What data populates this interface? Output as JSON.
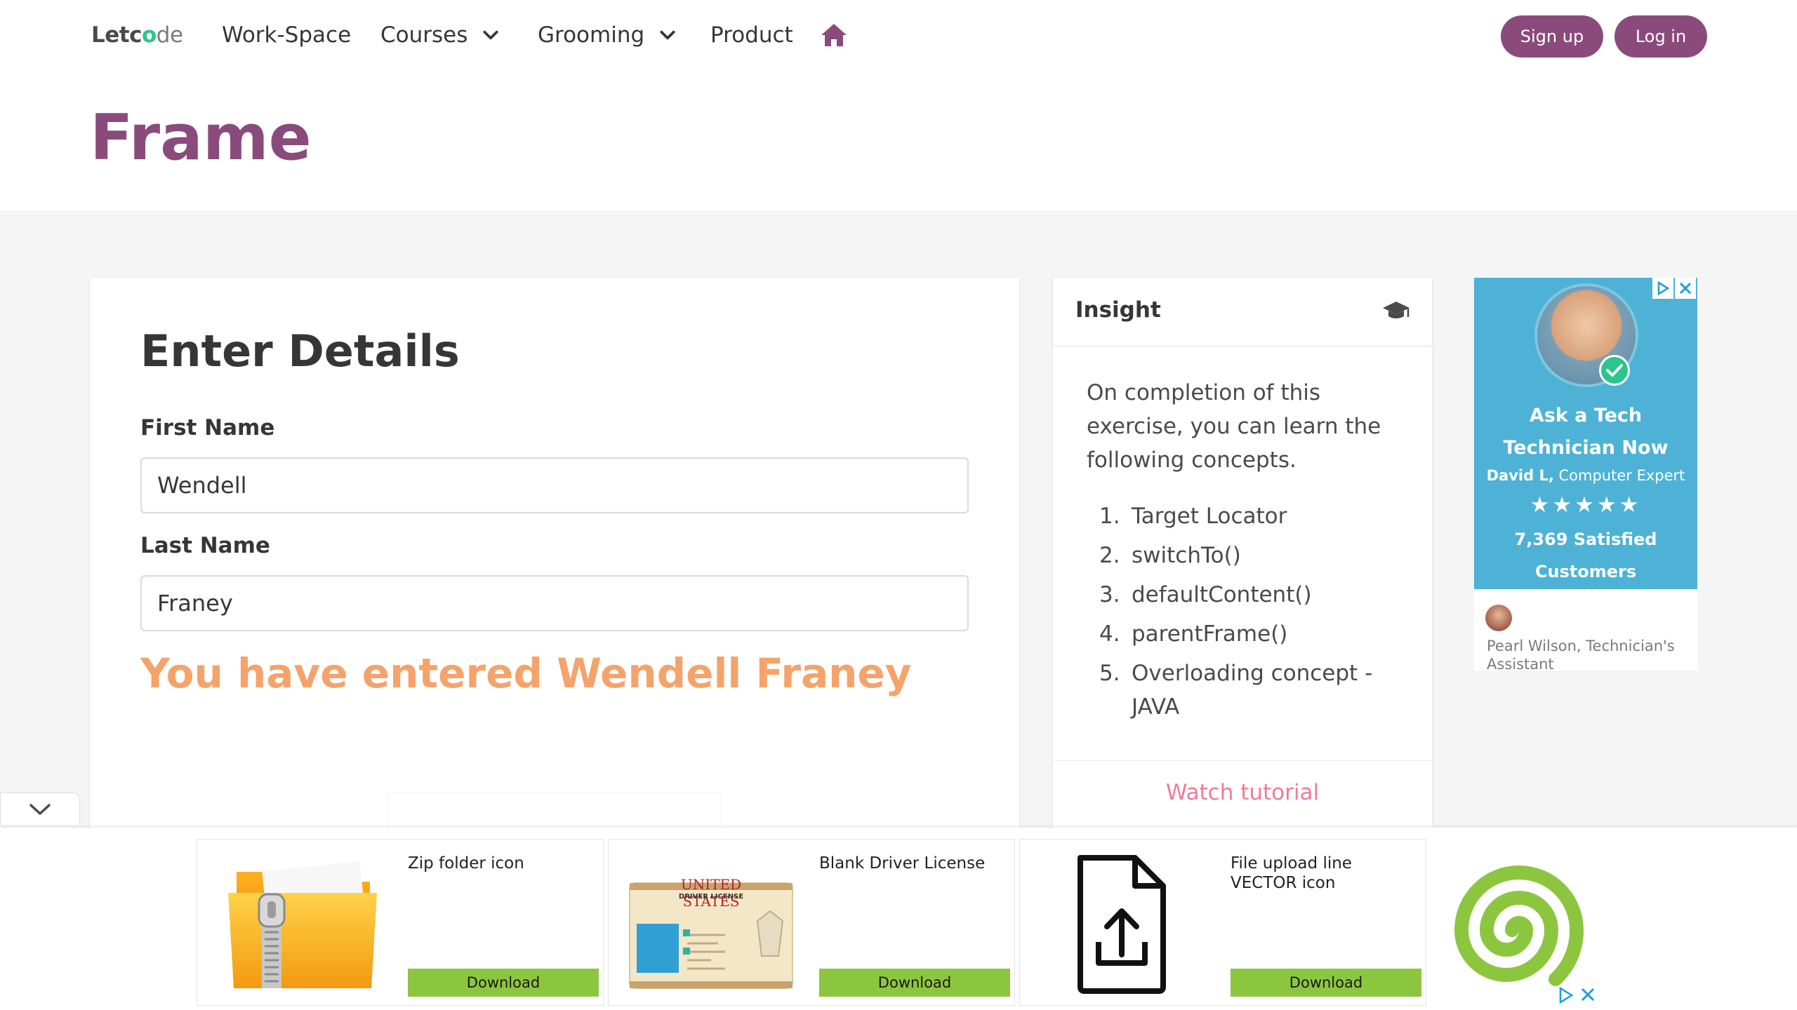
{
  "navbar": {
    "logo": {
      "part1": "Letc",
      "part2": "o",
      "part3": "de"
    },
    "items": [
      {
        "label": "Work-Space"
      },
      {
        "label": "Courses"
      },
      {
        "label": "Grooming"
      },
      {
        "label": "Product"
      }
    ],
    "signup_label": "Sign up",
    "login_label": "Log in",
    "accent_color": "#8a4b7c"
  },
  "hero": {
    "title": "Frame"
  },
  "form": {
    "heading": "Enter Details",
    "first_name_label": "First Name",
    "first_name_value": "Wendell",
    "last_name_label": "Last Name",
    "last_name_value": "Franey",
    "result_text": "You have entered Wendell Franey",
    "result_color": "#f5a36a"
  },
  "insight": {
    "title": "Insight",
    "icon": "graduation-cap-icon",
    "description": "On completion of this exercise, you can learn the following concepts.",
    "concepts": [
      {
        "num": "1.",
        "text": "Target Locator"
      },
      {
        "num": "2.",
        "text": "switchTo()"
      },
      {
        "num": "3.",
        "text": "defaultContent()"
      },
      {
        "num": "4.",
        "text": "parentFrame()"
      },
      {
        "num": "5.",
        "text": "Overloading concept - JAVA"
      }
    ],
    "watch_label": "Watch tutorial"
  },
  "side_ad": {
    "headline": "Ask a Tech Technician Now",
    "expert_name": "David L,",
    "expert_role": "Computer Expert",
    "stars": "★★★★★",
    "satisfied": "7,369 Satisfied Customers",
    "assistant": "Pearl Wilson, Technician's Assistant",
    "bg_color": "#4db2d6"
  },
  "bottom_ads": [
    {
      "title": "Zip folder icon",
      "button": "Download"
    },
    {
      "title": "Blank Driver License",
      "button": "Download"
    },
    {
      "title": "File upload line VECTOR icon",
      "button": "Download"
    }
  ],
  "license_card": {
    "header": "UNITED STATES",
    "sub": "DRIVER LICENSE"
  }
}
